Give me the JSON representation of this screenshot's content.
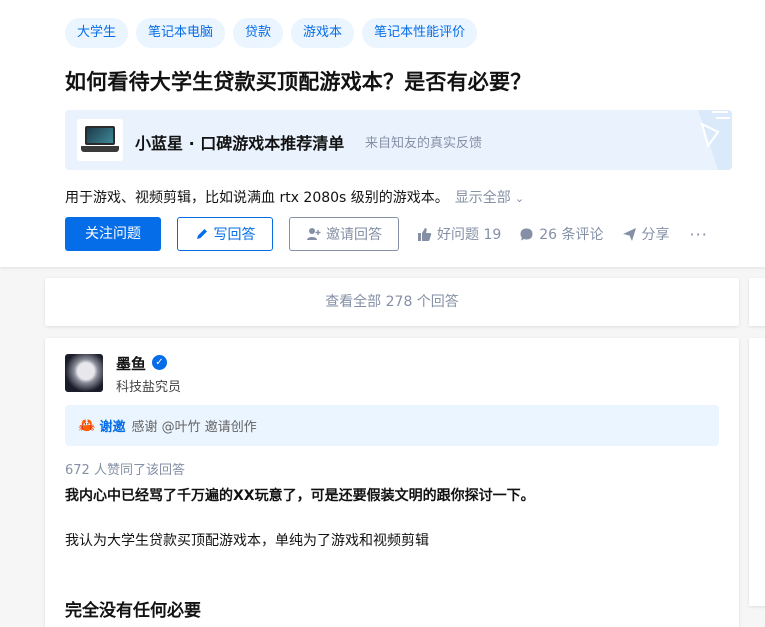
{
  "topics": [
    "大学生",
    "笔记本电脑",
    "贷款",
    "游戏本",
    "笔记本性能评价"
  ],
  "question": {
    "title": "如何看待大学生贷款买顶配游戏本？是否有必要？",
    "excerpt": "用于游戏、视频剪辑，比如说满血 rtx 2080s 级别的游戏本。",
    "show_all": "显示全部"
  },
  "banner": {
    "title": "小蓝星 · 口碑游戏本推荐清单",
    "subtitle": "来自知友的真实反馈"
  },
  "actions": {
    "follow": "关注问题",
    "write": "写回答",
    "invite": "邀请回答",
    "good_question": "好问题 19",
    "comments": "26 条评论",
    "share": "分享",
    "more": "···"
  },
  "view_all": "查看全部 278 个回答",
  "answer": {
    "author": "墨鱼",
    "bio": "科技盐究员",
    "thanks_label": "谢邀",
    "thanks_text": "感谢 @叶竹 邀请创作",
    "votes": "672 人赞同了该回答",
    "para1": "我内心中已经骂了千万遍的XX玩意了，可是还要假装文明的跟你探讨一下。",
    "para2": "我认为大学生贷款买顶配游戏本，单纯为了游戏和视频剪辑",
    "heading": "完全没有任何必要"
  },
  "colors": {
    "brand_blue": "#056de8",
    "topic_bg": "#ebf5ff",
    "muted": "#8590a6"
  }
}
